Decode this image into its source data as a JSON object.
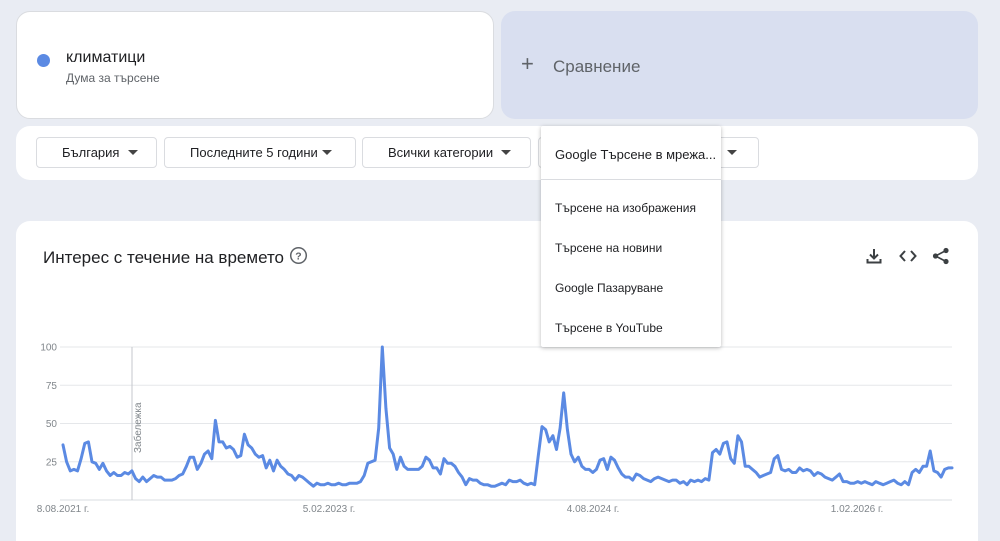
{
  "term": {
    "name": "климатици",
    "subtitle": "Дума за търсене",
    "color": "#5b8ae3"
  },
  "compare": {
    "label": "Сравнение"
  },
  "filters": {
    "region": "България",
    "period": "Последните 5 години",
    "category": "Всички категории",
    "search_type": "Google Търсене в мрежа..."
  },
  "search_type_menu": {
    "selected": "Google Търсене в мрежа...",
    "options": [
      "Търсене на изображения",
      "Търсене на новини",
      "Google Пазаруване",
      "Търсене в YouTube"
    ]
  },
  "chart_section": {
    "title": "Интерес с течение на времето"
  },
  "chart_data": {
    "type": "line",
    "title": "Интерес с течение на времето",
    "ylim": [
      0,
      100
    ],
    "yticks": [
      "100",
      "75",
      "50",
      "25"
    ],
    "xticks": [
      "8.08.2021 г.",
      "5.02.2023 г.",
      "4.08.2024 г.",
      "1.02.2026 г."
    ],
    "annotation": "Забележка",
    "grid": true,
    "series": [
      {
        "values": [
          36,
          25,
          19,
          20,
          19,
          27,
          37,
          38,
          25,
          24,
          20,
          24,
          19,
          16,
          18,
          16,
          16,
          18,
          17,
          19,
          14,
          12,
          15,
          12,
          14,
          16,
          15,
          15,
          13,
          13,
          13,
          14,
          16,
          17,
          22,
          28,
          28,
          20,
          24,
          30,
          32,
          27,
          52,
          38,
          38,
          34,
          35,
          33,
          28,
          29,
          43,
          36,
          34,
          30,
          28,
          29,
          21,
          26,
          19,
          26,
          22,
          20,
          17,
          16,
          13,
          16,
          15,
          13,
          11,
          9,
          11,
          10,
          10,
          11,
          10,
          10,
          11,
          10,
          10,
          11,
          11,
          11,
          12,
          16,
          24,
          25,
          26,
          47,
          100,
          60,
          34,
          30,
          20,
          28,
          22,
          20,
          20,
          20,
          20,
          22,
          28,
          26,
          21,
          21,
          17,
          27,
          24,
          24,
          22,
          18,
          15,
          10,
          14,
          13,
          13,
          11,
          10,
          10,
          9,
          9,
          10,
          11,
          10,
          13,
          12,
          12,
          13,
          11,
          10,
          11,
          10,
          29,
          48,
          46,
          38,
          42,
          33,
          47,
          70,
          46,
          30,
          25,
          28,
          22,
          20,
          20,
          18,
          20,
          26,
          27,
          20,
          28,
          26,
          21,
          17,
          15,
          15,
          13,
          17,
          16,
          14,
          13,
          12,
          14,
          15,
          14,
          13,
          12,
          13,
          13,
          11,
          12,
          10,
          13,
          12,
          13,
          12,
          14,
          13,
          31,
          33,
          30,
          37,
          38,
          27,
          24,
          42,
          38,
          22,
          22,
          20,
          18,
          15,
          16,
          17,
          18,
          27,
          29,
          20,
          19,
          20,
          18,
          18,
          21,
          19,
          20,
          19,
          16,
          18,
          17,
          15,
          14,
          13,
          15,
          17,
          12,
          12,
          11,
          11,
          12,
          11,
          12,
          11,
          10,
          12,
          11,
          10,
          11,
          12,
          13,
          11,
          10,
          12,
          10,
          18,
          20,
          18,
          22,
          22,
          32,
          19,
          18,
          15,
          20,
          21,
          21
        ]
      }
    ]
  }
}
